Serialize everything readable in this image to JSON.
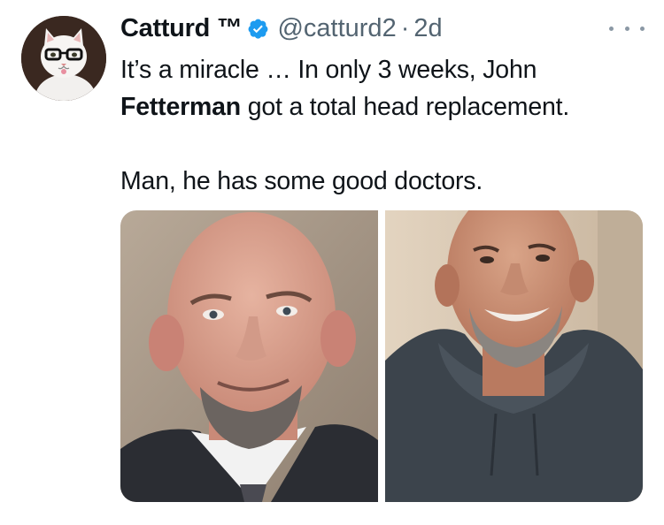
{
  "tweet": {
    "display_name": "Catturd ™",
    "handle": "@catturd2",
    "separator": "·",
    "time": "2d",
    "text_line1": "It’s a miracle … In only 3 weeks, John ",
    "text_bold": "Fetterman",
    "text_line2": " got a total head replacement.",
    "text_line3": "Man, he has some good doctors."
  },
  "icons": {
    "verified": "verified-badge-icon",
    "more": "more-options-icon"
  },
  "colors": {
    "text": "#0f1419",
    "secondary": "#536471",
    "verified_blue": "#1d9bf0"
  }
}
